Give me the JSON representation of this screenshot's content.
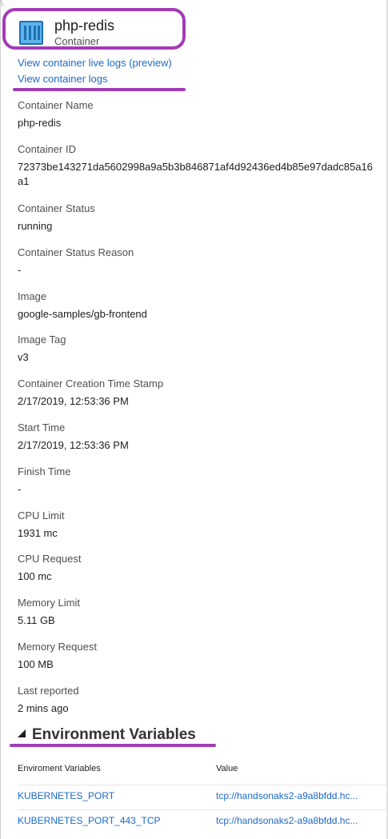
{
  "header": {
    "title": "php-redis",
    "subtitle": "Container",
    "icon": "container-icon"
  },
  "links": {
    "live_logs": "View container live logs (preview)",
    "logs": "View container logs"
  },
  "properties": [
    {
      "label": "Container Name",
      "value": "php-redis"
    },
    {
      "label": "Container ID",
      "value": "72373be143271da5602998a9a5b3b846871af4d92436ed4b85e97dadc85a16a1"
    },
    {
      "label": "Container Status",
      "value": "running"
    },
    {
      "label": "Container Status Reason",
      "value": "-"
    },
    {
      "label": "Image",
      "value": "google-samples/gb-frontend"
    },
    {
      "label": "Image Tag",
      "value": "v3"
    },
    {
      "label": "Container Creation Time Stamp",
      "value": "2/17/2019, 12:53:36 PM"
    },
    {
      "label": "Start Time",
      "value": "2/17/2019, 12:53:36 PM"
    },
    {
      "label": "Finish Time",
      "value": "-"
    },
    {
      "label": "CPU Limit",
      "value": "1931 mc"
    },
    {
      "label": "CPU Request",
      "value": "100 mc"
    },
    {
      "label": "Memory Limit",
      "value": "5.11 GB"
    },
    {
      "label": "Memory Request",
      "value": "100 MB"
    },
    {
      "label": "Last reported",
      "value": "2 mins ago"
    }
  ],
  "env": {
    "section_title": "Environment Variables",
    "columns": [
      "Enviroment Variables",
      "Value"
    ],
    "rows": [
      {
        "name": "KUBERNETES_PORT",
        "value": "tcp://handsonaks2-a9a8bfdd.hc..."
      },
      {
        "name": "KUBERNETES_PORT_443_TCP",
        "value": "tcp://handsonaks2-a9a8bfdd.hc..."
      }
    ]
  },
  "colors": {
    "highlight": "#a23cb6",
    "link": "#1b6ac9",
    "icon_fill": "#5fb4e8"
  }
}
